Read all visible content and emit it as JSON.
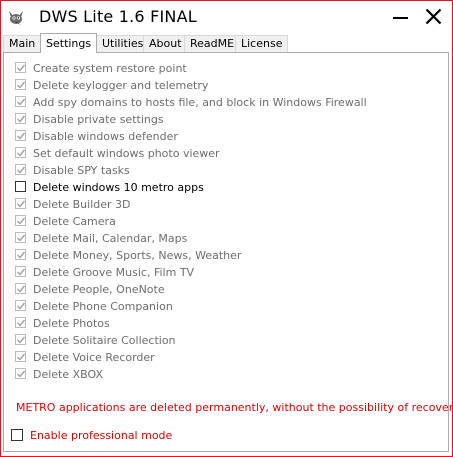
{
  "window": {
    "title": "DWS Lite 1.6 FINAL",
    "accent_border_color": "#e81123"
  },
  "tabs": [
    {
      "label": "Main",
      "active": false
    },
    {
      "label": "Settings",
      "active": true
    },
    {
      "label": "Utilities",
      "active": false
    },
    {
      "label": "About",
      "active": false
    },
    {
      "label": "ReadME",
      "active": false
    },
    {
      "label": "License",
      "active": false
    }
  ],
  "settings": {
    "options": [
      {
        "label": "Create system restore point",
        "checked": true,
        "enabled": false
      },
      {
        "label": "Delete keylogger and telemetry",
        "checked": true,
        "enabled": false
      },
      {
        "label": "Add spy domains to hosts file, and block in Windows Firewall",
        "checked": true,
        "enabled": false
      },
      {
        "label": "Disable private settings",
        "checked": true,
        "enabled": false
      },
      {
        "label": "Disable windows defender",
        "checked": true,
        "enabled": false
      },
      {
        "label": "Set default windows photo viewer",
        "checked": true,
        "enabled": false
      },
      {
        "label": "Disable SPY tasks",
        "checked": true,
        "enabled": false
      },
      {
        "label": "Delete windows 10 metro apps",
        "checked": false,
        "enabled": true
      },
      {
        "label": "Delete Builder 3D",
        "checked": true,
        "enabled": false
      },
      {
        "label": "Delete Camera",
        "checked": true,
        "enabled": false
      },
      {
        "label": "Delete Mail, Calendar, Maps",
        "checked": true,
        "enabled": false
      },
      {
        "label": "Delete Money, Sports, News, Weather",
        "checked": true,
        "enabled": false
      },
      {
        "label": "Delete Groove Music, Film TV",
        "checked": true,
        "enabled": false
      },
      {
        "label": "Delete People, OneNote",
        "checked": true,
        "enabled": false
      },
      {
        "label": "Delete Phone Companion",
        "checked": true,
        "enabled": false
      },
      {
        "label": "Delete Photos",
        "checked": true,
        "enabled": false
      },
      {
        "label": "Delete Solitaire Collection",
        "checked": true,
        "enabled": false
      },
      {
        "label": "Delete Voice Recorder",
        "checked": true,
        "enabled": false
      },
      {
        "label": "Delete XBOX",
        "checked": true,
        "enabled": false
      }
    ],
    "warning_text": "METRO applications are deleted permanently, without the possibility of recovery.",
    "warning_color": "#e00000",
    "professional_mode": {
      "label": "Enable professional mode",
      "checked": false
    }
  },
  "icons": {
    "app": "gimp-style-mascot-icon",
    "minimize": "minimize-icon",
    "close": "close-icon",
    "check": "checkmark-icon"
  }
}
